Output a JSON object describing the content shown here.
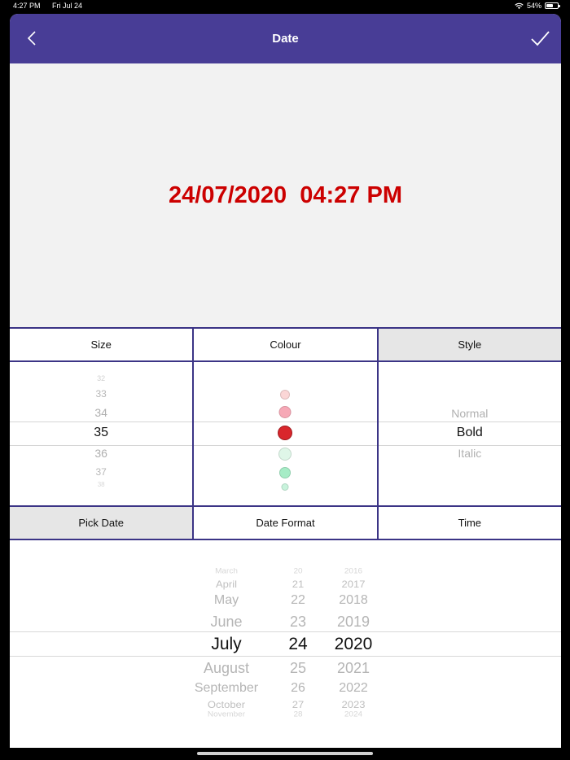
{
  "status_bar": {
    "time": "4:27 PM",
    "date": "Fri Jul 24",
    "battery": "54%"
  },
  "nav": {
    "title": "Date",
    "back_icon": "chevron-left-icon",
    "done_icon": "checkmark-icon"
  },
  "preview": {
    "text": "24/07/2020  04:27 PM",
    "color": "#cc0000"
  },
  "tabs_top": [
    {
      "label": "Size",
      "active": false
    },
    {
      "label": "Colour",
      "active": false
    },
    {
      "label": "Style",
      "active": true
    }
  ],
  "size_picker": {
    "items": [
      "32",
      "33",
      "34",
      "35",
      "36",
      "37",
      "38"
    ],
    "selected": "35"
  },
  "colour_picker": {
    "swatches": [
      "#fbd6d6",
      "#f6a8b6",
      "#d9262c",
      "#dff6e8",
      "#a6ecc6",
      "#c8f3dc"
    ],
    "selected_index": 2
  },
  "style_picker": {
    "items": [
      "Normal",
      "Bold",
      "Italic"
    ],
    "selected": "Bold"
  },
  "tabs_bottom": [
    {
      "label": "Pick Date",
      "active": true
    },
    {
      "label": "Date Format",
      "active": false
    },
    {
      "label": "Time",
      "active": false
    }
  ],
  "date_picker": {
    "months": [
      "March",
      "April",
      "May",
      "June",
      "July",
      "August",
      "September",
      "October",
      "November"
    ],
    "days": [
      "20",
      "21",
      "22",
      "23",
      "24",
      "25",
      "26",
      "27",
      "28"
    ],
    "years": [
      "2016",
      "2017",
      "2018",
      "2019",
      "2020",
      "2021",
      "2022",
      "2023",
      "2024"
    ],
    "selected": {
      "month": "July",
      "day": "24",
      "year": "2020"
    }
  }
}
